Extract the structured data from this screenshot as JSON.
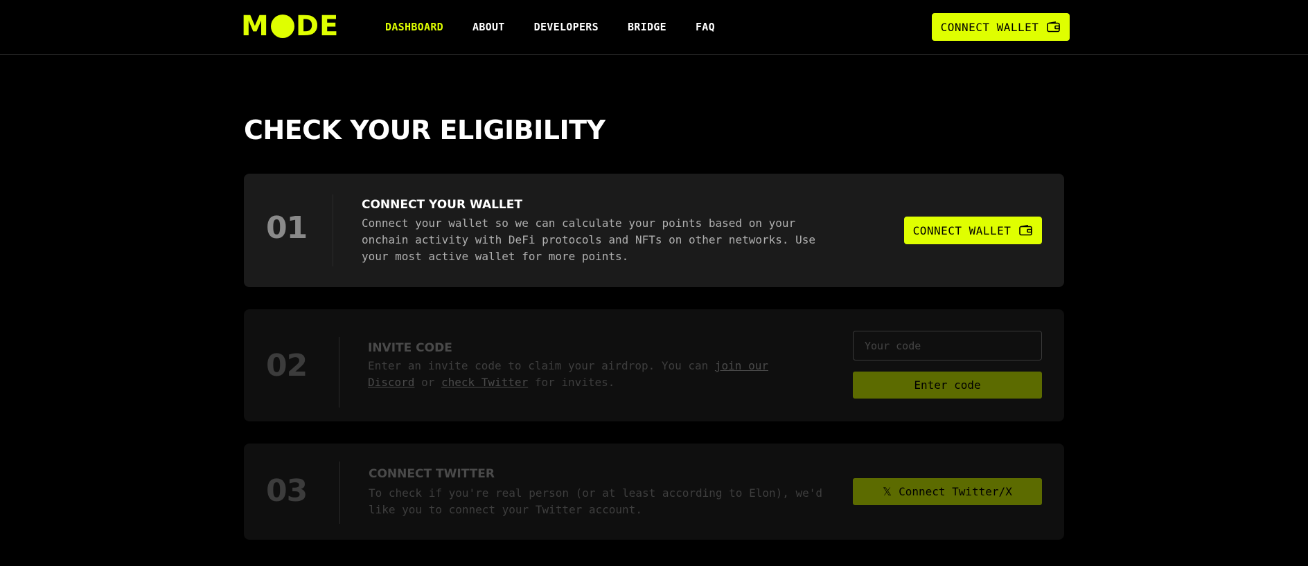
{
  "header": {
    "logo_left": "M",
    "logo_right": "DE",
    "nav": [
      {
        "label": "DASHBOARD",
        "active": true
      },
      {
        "label": "ABOUT",
        "active": false
      },
      {
        "label": "DEVELOPERS",
        "active": false
      },
      {
        "label": "BRIDGE",
        "active": false
      },
      {
        "label": "FAQ",
        "active": false
      }
    ],
    "connect_label": "CONNECT WALLET"
  },
  "page": {
    "title": "CHECK YOUR ELIGIBILITY"
  },
  "steps": [
    {
      "number": "01",
      "title": "CONNECT YOUR WALLET",
      "description": "Connect your wallet so we can calculate your points based on your onchain activity with DeFi protocols and NFTs on other networks. Use your most active wallet for more points.",
      "button_label": "CONNECT WALLET"
    },
    {
      "number": "02",
      "title": "INVITE CODE",
      "desc_pre": "Enter an invite code to claim your airdrop. You can ",
      "link_discord": "join our Discord",
      "desc_mid": " or ",
      "link_twitter": "check Twitter",
      "desc_post": " for invites.",
      "input_placeholder": "Your code",
      "button_label": "Enter code"
    },
    {
      "number": "03",
      "title": "CONNECT TWITTER",
      "description": "To check if you're real person (or at least according to Elon), we'd like you to connect your Twitter account.",
      "button_icon": "𝕏",
      "button_label": "Connect Twitter/X"
    }
  ],
  "colors": {
    "accent": "#dfff00",
    "accent_dim": "#5c6b00",
    "background": "#000000",
    "card_active": "#1b1b1b",
    "card_inactive": "#0f0f0f"
  }
}
